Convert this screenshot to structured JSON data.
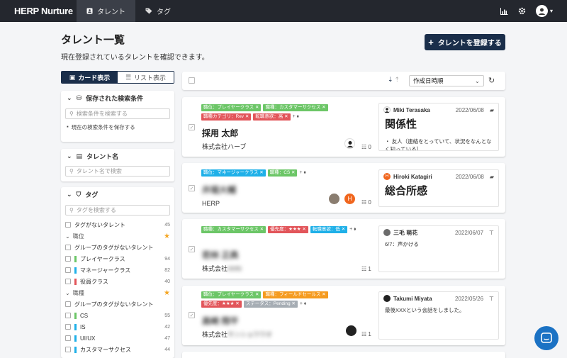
{
  "app": {
    "brand": "HERP Nurture",
    "nav": [
      {
        "label": "タレント",
        "active": true
      },
      {
        "label": "タグ",
        "active": false
      }
    ]
  },
  "page": {
    "title": "タレント一覧",
    "description": "現在登録されているタレントを確認できます。",
    "register_label": "タレントを登録する"
  },
  "view_toggle": {
    "card": "カード表示",
    "list": "リスト表示"
  },
  "saved_search": {
    "title": "保存された検索条件",
    "placeholder": "検索条件を検索する",
    "save_label": "現在の検索条件を保存する"
  },
  "talent_name": {
    "title": "タレント名",
    "placeholder": "タレント名で検索"
  },
  "tags_panel": {
    "title": "タグ",
    "placeholder": "タグを検索する",
    "untagged": {
      "label": "タグがないタレント",
      "count": "45"
    },
    "groups": [
      {
        "name": "職位",
        "none_label": "グループのタグがないタレント",
        "items": [
          {
            "label": "プレイヤークラス",
            "count": "94",
            "color": "#6cc667"
          },
          {
            "label": "マネージャークラス",
            "count": "82",
            "color": "#1fb0e8"
          },
          {
            "label": "役員クラス",
            "count": "40",
            "color": "#e2555a"
          }
        ]
      },
      {
        "name": "職種",
        "none_label": "グループのタグがないタレント",
        "items": [
          {
            "label": "CS",
            "count": "55",
            "color": "#6cc667"
          },
          {
            "label": "IS",
            "count": "42",
            "color": "#1fb0e8"
          },
          {
            "label": "UI/UX",
            "count": "47",
            "color": "#1fb0e8"
          },
          {
            "label": "カスタマーサクセス",
            "count": "44",
            "color": "#1fb0e8"
          }
        ]
      }
    ]
  },
  "toolbar": {
    "sort_label": "作成日時順"
  },
  "cards": [
    {
      "tags": [
        {
          "t": "職位：プレイヤークラス",
          "c": "g"
        },
        {
          "t": "職種：カスタマーサクセス",
          "c": "g"
        },
        {
          "t": "職種カテゴリ：Rev",
          "c": "r"
        },
        {
          "t": "転職意欲：高",
          "c": "r"
        }
      ],
      "name": "採用 太郎",
      "company": "株式会社ハーブ",
      "count": "0",
      "memo": {
        "author": "Miki Terasaka",
        "date": "2022/06/08",
        "big": "関係性",
        "text": "・ 友人（連絡をとっていて、状況をなんとなく知っている）"
      }
    },
    {
      "tags": [
        {
          "t": "職位：マネージャークラス",
          "c": "c"
        },
        {
          "t": "職種：CS",
          "c": "g"
        }
      ],
      "name": "井堀大輔",
      "company": "HERP",
      "count": "0",
      "avatar_letter": "H",
      "memo": {
        "author": "Hiroki Katagiri",
        "date": "2022/06/08",
        "big": "総合所感",
        "text": ""
      }
    },
    {
      "tags": [
        {
          "t": "職種：カスタマーサクセス",
          "c": "g"
        },
        {
          "t": "優先度：★★★",
          "c": "r"
        },
        {
          "t": "転職意欲：低",
          "c": "c"
        }
      ],
      "name": "若林 正典",
      "company": "株式会社",
      "company_blur": "HHN",
      "count": "1",
      "memo": {
        "author": "三毛 萌花",
        "date": "2022/06/07",
        "big": "",
        "text": "6/7：声かける"
      }
    },
    {
      "tags": [
        {
          "t": "職位：プレイヤークラス",
          "c": "g"
        },
        {
          "t": "職種：フィールドセールス",
          "c": "o"
        },
        {
          "t": "優先度：★★★",
          "c": "r"
        },
        {
          "t": "ステータス：Pending",
          "c": "y"
        }
      ],
      "name": "高崎 翔平",
      "company": "株式会社",
      "company_blur": "サンショウウオ",
      "count": "1",
      "memo": {
        "author": "Takumi Miyata",
        "date": "2022/05/26",
        "big": "",
        "text": "最後XXXという会話をしました。"
      }
    }
  ]
}
